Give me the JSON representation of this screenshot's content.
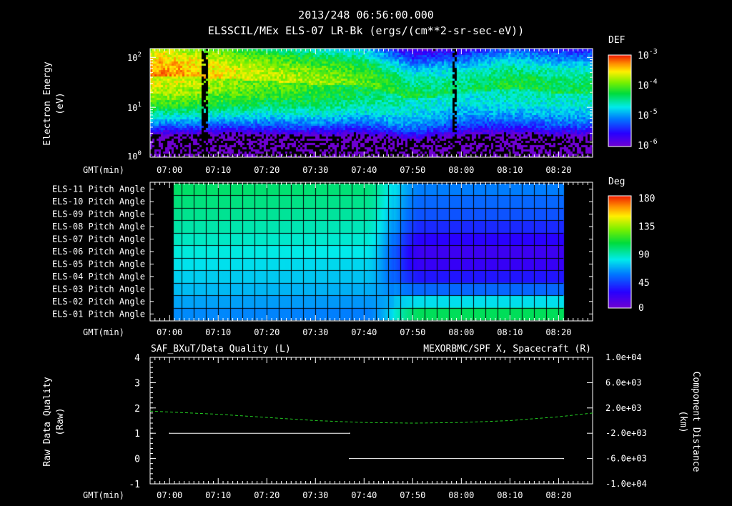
{
  "header": {
    "title": "2013/248 06:56:00.000",
    "subtitle": "ELSSCIL/MEx ELS-07 LR-Bk  (ergs/(cm**2-sr-sec-eV))"
  },
  "time_axis": {
    "label": "GMT(min)",
    "ticks": [
      "07:00",
      "07:10",
      "07:20",
      "07:30",
      "07:40",
      "07:50",
      "08:00",
      "08:10",
      "08:20"
    ]
  },
  "panel1": {
    "ylabel_line1": "Electron Energy",
    "ylabel_line2": "(eV)",
    "yticks": [
      {
        "base": "10",
        "exp": "2"
      },
      {
        "base": "10",
        "exp": "1"
      },
      {
        "base": "10",
        "exp": "0"
      }
    ],
    "colorbar_title": "DEF",
    "colorbar_ticks": [
      {
        "base": "10",
        "exp": "-3"
      },
      {
        "base": "10",
        "exp": "-4"
      },
      {
        "base": "10",
        "exp": "-5"
      },
      {
        "base": "10",
        "exp": "-6"
      }
    ]
  },
  "panel2": {
    "row_labels": [
      "ELS-11 Pitch Angle",
      "ELS-10 Pitch Angle",
      "ELS-09 Pitch Angle",
      "ELS-08 Pitch Angle",
      "ELS-07 Pitch Angle",
      "ELS-06 Pitch Angle",
      "ELS-05 Pitch Angle",
      "ELS-04 Pitch Angle",
      "ELS-03 Pitch Angle",
      "ELS-02 Pitch Angle",
      "ELS-01 Pitch Angle"
    ],
    "colorbar_title": "Deg",
    "colorbar_ticks": [
      "180",
      "135",
      "90",
      "45",
      "0"
    ]
  },
  "panel3": {
    "left_title": "SAF_BXuT/Data Quality (L)",
    "right_title": "MEXORBMC/SPF X, Spacecraft (R)",
    "right_title_color": "#22cc22",
    "ylabel_left_line1": "Raw Data Quality",
    "ylabel_left_line2": "(Raw)",
    "ylabel_right_line1": "Component Distance",
    "ylabel_right_line2": "(km)",
    "left_ticks": [
      "4",
      "3",
      "2",
      "1",
      "0",
      "-1"
    ],
    "right_ticks": [
      "1.0e+04",
      "6.0e+03",
      "2.0e+03",
      "-2.0e+03",
      "-6.0e+03",
      "-1.0e+04"
    ]
  },
  "chart_data": [
    {
      "type": "heatmap",
      "title": "ELSSCIL/MEx ELS-07 LR-Bk  (ergs/(cm**2-sr-sec-eV))",
      "xlabel": "GMT(min)",
      "ylabel": "Electron Energy (eV)",
      "x_range": [
        "06:56",
        "08:27"
      ],
      "y_range": [
        1,
        150
      ],
      "y_scale": "log",
      "color_label": "DEF",
      "color_range": [
        1e-06,
        0.001
      ],
      "color_scale": "log",
      "colormap": "rainbow",
      "peak_band": [
        {
          "time": "07:00",
          "energy_ev": 45,
          "def": 0.0005
        },
        {
          "time": "07:10",
          "energy_ev": 40,
          "def": 0.0003
        },
        {
          "time": "07:20",
          "energy_ev": 35,
          "def": 0.0002
        },
        {
          "time": "07:30",
          "energy_ev": 30,
          "def": 0.00015
        },
        {
          "time": "07:40",
          "energy_ev": 28,
          "def": 0.0001
        },
        {
          "time": "07:50",
          "energy_ev": 15,
          "def": 5e-05
        },
        {
          "time": "08:00",
          "energy_ev": 20,
          "def": 4e-05
        },
        {
          "time": "08:10",
          "energy_ev": 25,
          "def": 6e-05
        },
        {
          "time": "08:20",
          "energy_ev": 20,
          "def": 5e-05
        }
      ]
    },
    {
      "type": "heatmap",
      "xlabel": "GMT(min)",
      "color_label": "Deg",
      "color_range": [
        0,
        180
      ],
      "colormap": "rainbow",
      "x_range": [
        "06:56",
        "08:27"
      ],
      "data_time_range": [
        "07:00",
        "08:21"
      ],
      "rows": [
        "ELS-11",
        "ELS-10",
        "ELS-09",
        "ELS-08",
        "ELS-07",
        "ELS-06",
        "ELS-05",
        "ELS-04",
        "ELS-03",
        "ELS-02",
        "ELS-01"
      ],
      "pitch_angle_deg_before_0745": [
        98,
        95,
        92,
        88,
        84,
        80,
        76,
        72,
        68,
        63,
        58
      ],
      "pitch_angle_deg_after_0755": [
        55,
        50,
        45,
        35,
        25,
        18,
        20,
        30,
        50,
        75,
        100
      ]
    },
    {
      "type": "line",
      "title": "SAF_BXuT/Data Quality (L)",
      "x_range": [
        "06:56",
        "08:27"
      ],
      "ylim_left": [
        -1,
        4
      ],
      "ylim_right": [
        -10000,
        10000
      ],
      "series": [
        {
          "name": "SAF_BXuT/Data Quality (L)",
          "axis": "left",
          "color": "#ffffff",
          "x": [
            "07:00",
            "07:37",
            "07:37",
            "08:21"
          ],
          "values": [
            1,
            1,
            0,
            0
          ]
        },
        {
          "name": "MEXORBMC/SPF X, Spacecraft (R)",
          "axis": "right",
          "color": "#22cc22",
          "style": "dashed",
          "x": [
            "06:56",
            "07:10",
            "07:20",
            "07:30",
            "07:40",
            "07:50",
            "08:00",
            "08:10",
            "08:20",
            "08:27"
          ],
          "values": [
            1500,
            1000,
            500,
            0,
            -300,
            -400,
            -300,
            0,
            600,
            1200
          ]
        }
      ]
    }
  ]
}
